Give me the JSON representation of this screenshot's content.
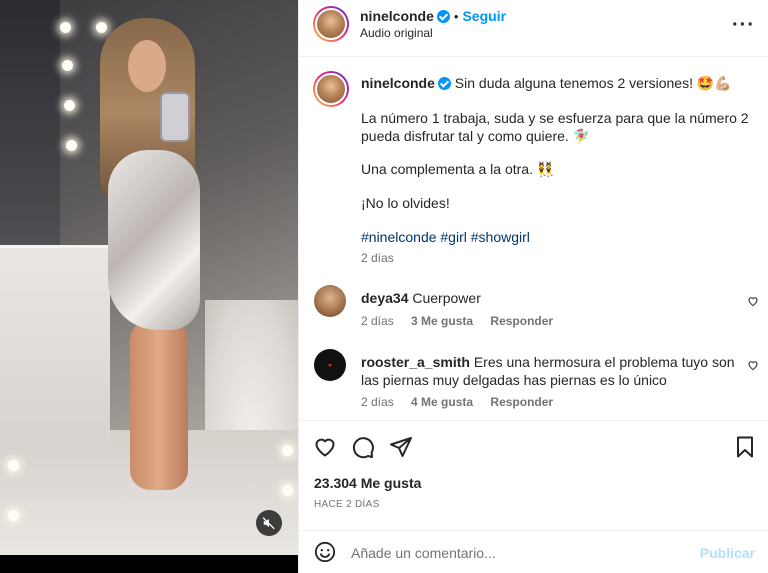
{
  "header": {
    "username": "ninelconde",
    "separator": "•",
    "follow_label": "Seguir",
    "audio_label": "Audio original",
    "more_label": "···"
  },
  "caption": {
    "username": "ninelconde",
    "line1": "Sin duda alguna tenemos 2 versiones! 🤩💪🏼",
    "line2": "La número 1 trabaja, suda y se esfuerza para que la número 2 pueda disfrutar tal y como quiere. 🧚‍♀️",
    "line3": "Una complementa a la otra. 👯",
    "line4": "¡No lo olvides!",
    "hashtags": "#ninelconde #girl #showgirl",
    "time": "2 días"
  },
  "comments": [
    {
      "username": "deya34",
      "text": "Cuerpower",
      "time": "2 días",
      "likes": "3 Me gusta",
      "reply": "Responder"
    },
    {
      "username": "rooster_a_smith",
      "text": "Eres una hermosura el problema tuyo son las piernas muy delgadas has piernas es lo único",
      "time": "2 días",
      "likes": "4 Me gusta",
      "reply": "Responder"
    }
  ],
  "actions": {
    "likes_count": "23.304 Me gusta",
    "posted_ago": "HACE 2 DÍAS"
  },
  "composer": {
    "placeholder": "Añade un comentario...",
    "post_label": "Publicar"
  },
  "colors": {
    "accent": "#0095f6",
    "hashtag": "#00376b",
    "muted": "#737373"
  }
}
